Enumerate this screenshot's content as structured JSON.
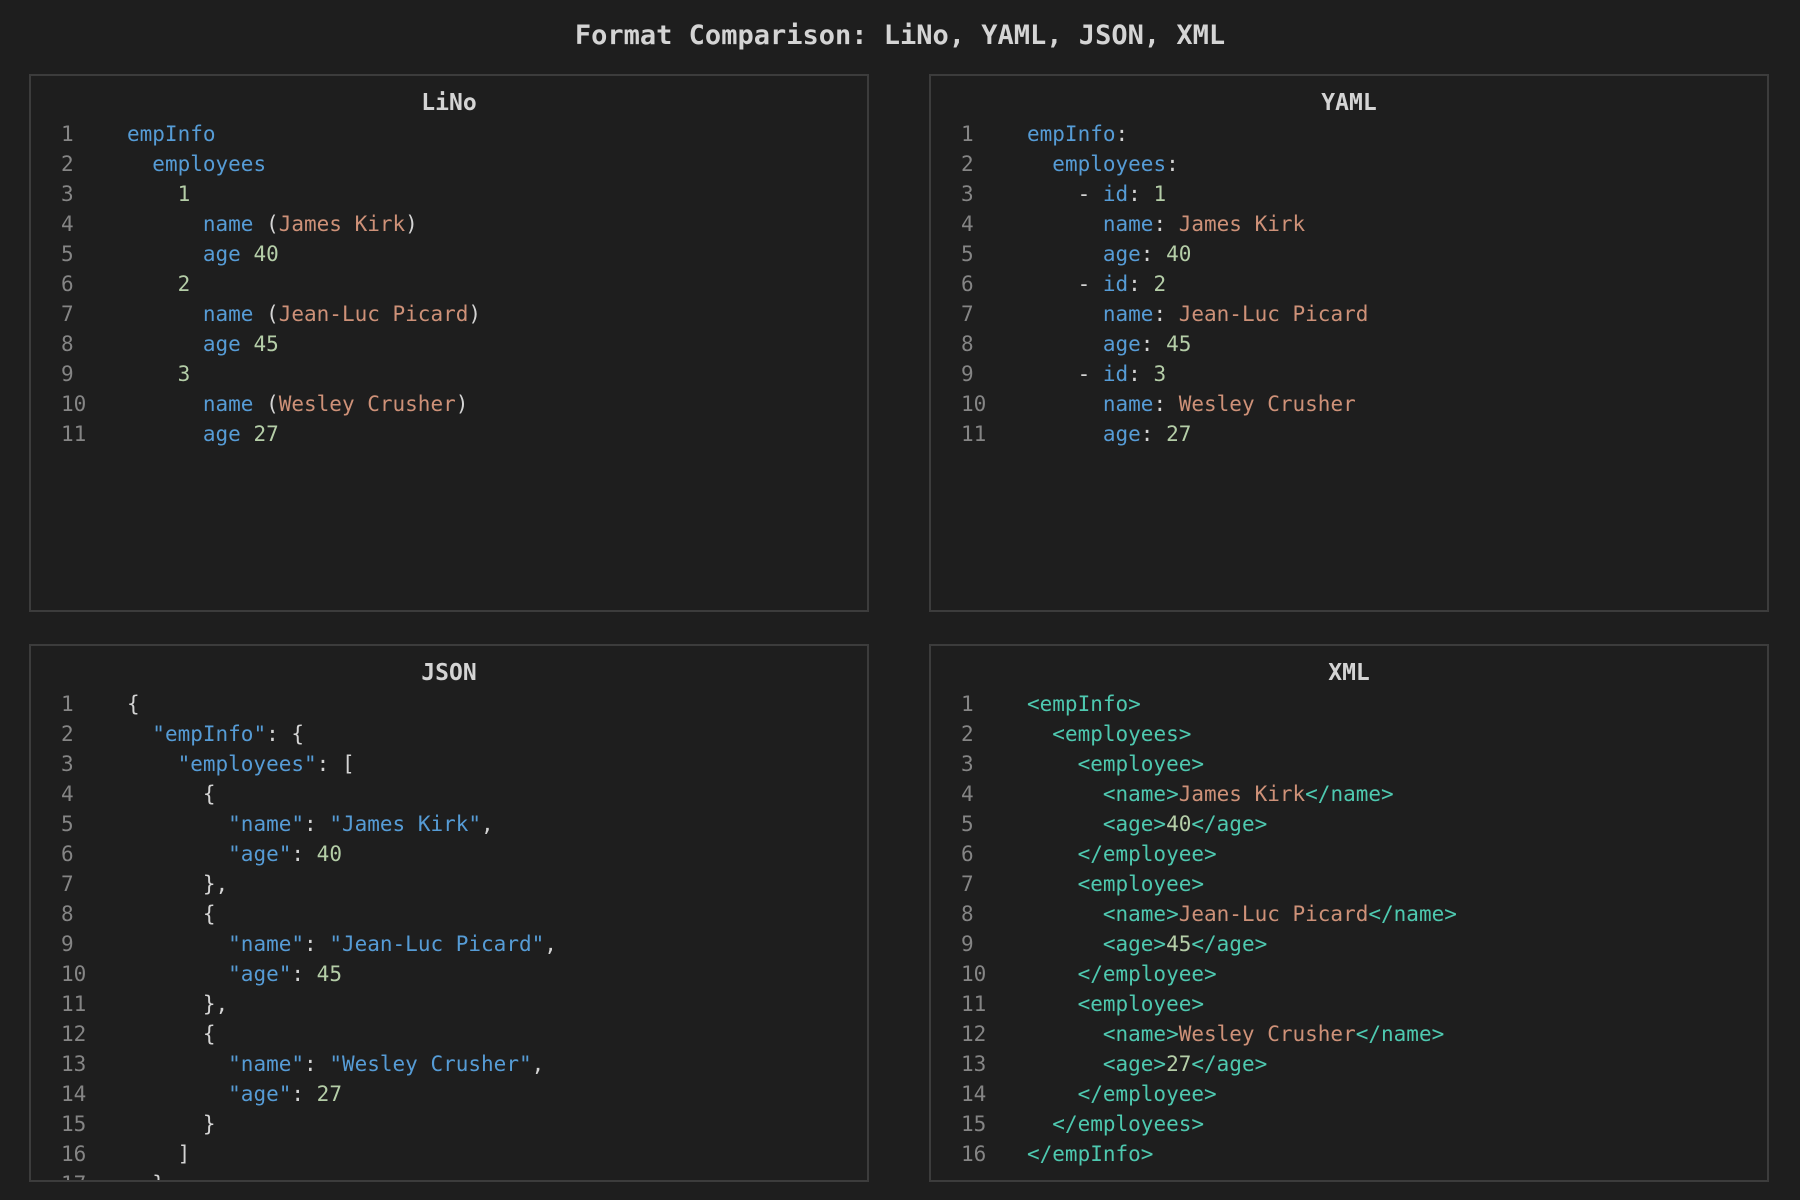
{
  "title": "Format Comparison: LiNo, YAML, JSON, XML",
  "colors": {
    "background": "#1e1e1e",
    "key": "#569cd6",
    "string": "#ce9178",
    "number": "#b5cea8",
    "punctuation": "#d4d4d4",
    "tag": "#4ec9b0",
    "line_number": "#858585",
    "border": "#3c3c3c"
  },
  "panels": [
    {
      "name": "LiNo",
      "lines": [
        [
          {
            "t": "empInfo",
            "c": "k"
          }
        ],
        [
          {
            "t": "  "
          },
          {
            "t": "employees",
            "c": "k"
          }
        ],
        [
          {
            "t": "    "
          },
          {
            "t": "1",
            "c": "n"
          }
        ],
        [
          {
            "t": "      "
          },
          {
            "t": "name",
            "c": "k"
          },
          {
            "t": " (",
            "c": "p"
          },
          {
            "t": "James Kirk",
            "c": "s"
          },
          {
            "t": ")",
            "c": "p"
          }
        ],
        [
          {
            "t": "      "
          },
          {
            "t": "age",
            "c": "k"
          },
          {
            "t": " "
          },
          {
            "t": "40",
            "c": "n"
          }
        ],
        [
          {
            "t": "    "
          },
          {
            "t": "2",
            "c": "n"
          }
        ],
        [
          {
            "t": "      "
          },
          {
            "t": "name",
            "c": "k"
          },
          {
            "t": " (",
            "c": "p"
          },
          {
            "t": "Jean-Luc Picard",
            "c": "s"
          },
          {
            "t": ")",
            "c": "p"
          }
        ],
        [
          {
            "t": "      "
          },
          {
            "t": "age",
            "c": "k"
          },
          {
            "t": " "
          },
          {
            "t": "45",
            "c": "n"
          }
        ],
        [
          {
            "t": "    "
          },
          {
            "t": "3",
            "c": "n"
          }
        ],
        [
          {
            "t": "      "
          },
          {
            "t": "name",
            "c": "k"
          },
          {
            "t": " (",
            "c": "p"
          },
          {
            "t": "Wesley Crusher",
            "c": "s"
          },
          {
            "t": ")",
            "c": "p"
          }
        ],
        [
          {
            "t": "      "
          },
          {
            "t": "age",
            "c": "k"
          },
          {
            "t": " "
          },
          {
            "t": "27",
            "c": "n"
          }
        ]
      ]
    },
    {
      "name": "YAML",
      "lines": [
        [
          {
            "t": "empInfo",
            "c": "k"
          },
          {
            "t": ":",
            "c": "p"
          }
        ],
        [
          {
            "t": "  "
          },
          {
            "t": "employees",
            "c": "k"
          },
          {
            "t": ":",
            "c": "p"
          }
        ],
        [
          {
            "t": "    "
          },
          {
            "t": "- ",
            "c": "p"
          },
          {
            "t": "id",
            "c": "k"
          },
          {
            "t": ": ",
            "c": "p"
          },
          {
            "t": "1",
            "c": "n"
          }
        ],
        [
          {
            "t": "      "
          },
          {
            "t": "name",
            "c": "k"
          },
          {
            "t": ": ",
            "c": "p"
          },
          {
            "t": "James Kirk",
            "c": "s"
          }
        ],
        [
          {
            "t": "      "
          },
          {
            "t": "age",
            "c": "k"
          },
          {
            "t": ": ",
            "c": "p"
          },
          {
            "t": "40",
            "c": "n"
          }
        ],
        [
          {
            "t": "    "
          },
          {
            "t": "- ",
            "c": "p"
          },
          {
            "t": "id",
            "c": "k"
          },
          {
            "t": ": ",
            "c": "p"
          },
          {
            "t": "2",
            "c": "n"
          }
        ],
        [
          {
            "t": "      "
          },
          {
            "t": "name",
            "c": "k"
          },
          {
            "t": ": ",
            "c": "p"
          },
          {
            "t": "Jean-Luc Picard",
            "c": "s"
          }
        ],
        [
          {
            "t": "      "
          },
          {
            "t": "age",
            "c": "k"
          },
          {
            "t": ": ",
            "c": "p"
          },
          {
            "t": "45",
            "c": "n"
          }
        ],
        [
          {
            "t": "    "
          },
          {
            "t": "- ",
            "c": "p"
          },
          {
            "t": "id",
            "c": "k"
          },
          {
            "t": ": ",
            "c": "p"
          },
          {
            "t": "3",
            "c": "n"
          }
        ],
        [
          {
            "t": "      "
          },
          {
            "t": "name",
            "c": "k"
          },
          {
            "t": ": ",
            "c": "p"
          },
          {
            "t": "Wesley Crusher",
            "c": "s"
          }
        ],
        [
          {
            "t": "      "
          },
          {
            "t": "age",
            "c": "k"
          },
          {
            "t": ": ",
            "c": "p"
          },
          {
            "t": "27",
            "c": "n"
          }
        ]
      ]
    },
    {
      "name": "JSON",
      "lines": [
        [
          {
            "t": "{",
            "c": "p"
          }
        ],
        [
          {
            "t": "  "
          },
          {
            "t": "\"empInfo\"",
            "c": "js"
          },
          {
            "t": ": {",
            "c": "p"
          }
        ],
        [
          {
            "t": "    "
          },
          {
            "t": "\"employees\"",
            "c": "js"
          },
          {
            "t": ": [",
            "c": "p"
          }
        ],
        [
          {
            "t": "      "
          },
          {
            "t": "{",
            "c": "p"
          }
        ],
        [
          {
            "t": "        "
          },
          {
            "t": "\"name\"",
            "c": "js"
          },
          {
            "t": ": ",
            "c": "p"
          },
          {
            "t": "\"James Kirk\"",
            "c": "js"
          },
          {
            "t": ",",
            "c": "p"
          }
        ],
        [
          {
            "t": "        "
          },
          {
            "t": "\"age\"",
            "c": "js"
          },
          {
            "t": ": ",
            "c": "p"
          },
          {
            "t": "40",
            "c": "n"
          }
        ],
        [
          {
            "t": "      "
          },
          {
            "t": "},",
            "c": "p"
          }
        ],
        [
          {
            "t": "      "
          },
          {
            "t": "{",
            "c": "p"
          }
        ],
        [
          {
            "t": "        "
          },
          {
            "t": "\"name\"",
            "c": "js"
          },
          {
            "t": ": ",
            "c": "p"
          },
          {
            "t": "\"Jean-Luc Picard\"",
            "c": "js"
          },
          {
            "t": ",",
            "c": "p"
          }
        ],
        [
          {
            "t": "        "
          },
          {
            "t": "\"age\"",
            "c": "js"
          },
          {
            "t": ": ",
            "c": "p"
          },
          {
            "t": "45",
            "c": "n"
          }
        ],
        [
          {
            "t": "      "
          },
          {
            "t": "},",
            "c": "p"
          }
        ],
        [
          {
            "t": "      "
          },
          {
            "t": "{",
            "c": "p"
          }
        ],
        [
          {
            "t": "        "
          },
          {
            "t": "\"name\"",
            "c": "js"
          },
          {
            "t": ": ",
            "c": "p"
          },
          {
            "t": "\"Wesley Crusher\"",
            "c": "js"
          },
          {
            "t": ",",
            "c": "p"
          }
        ],
        [
          {
            "t": "        "
          },
          {
            "t": "\"age\"",
            "c": "js"
          },
          {
            "t": ": ",
            "c": "p"
          },
          {
            "t": "27",
            "c": "n"
          }
        ],
        [
          {
            "t": "      "
          },
          {
            "t": "}",
            "c": "p"
          }
        ],
        [
          {
            "t": "    "
          },
          {
            "t": "]",
            "c": "p"
          }
        ],
        [
          {
            "t": "  "
          },
          {
            "t": "}",
            "c": "p"
          }
        ]
      ]
    },
    {
      "name": "XML",
      "lines": [
        [
          {
            "t": "<empInfo>",
            "c": "t"
          }
        ],
        [
          {
            "t": "  "
          },
          {
            "t": "<employees>",
            "c": "t"
          }
        ],
        [
          {
            "t": "    "
          },
          {
            "t": "<employee>",
            "c": "t"
          }
        ],
        [
          {
            "t": "      "
          },
          {
            "t": "<name>",
            "c": "t"
          },
          {
            "t": "James Kirk",
            "c": "s"
          },
          {
            "t": "</name>",
            "c": "t"
          }
        ],
        [
          {
            "t": "      "
          },
          {
            "t": "<age>",
            "c": "t"
          },
          {
            "t": "40",
            "c": "n"
          },
          {
            "t": "</age>",
            "c": "t"
          }
        ],
        [
          {
            "t": "    "
          },
          {
            "t": "</employee>",
            "c": "t"
          }
        ],
        [
          {
            "t": "    "
          },
          {
            "t": "<employee>",
            "c": "t"
          }
        ],
        [
          {
            "t": "      "
          },
          {
            "t": "<name>",
            "c": "t"
          },
          {
            "t": "Jean-Luc Picard",
            "c": "s"
          },
          {
            "t": "</name>",
            "c": "t"
          }
        ],
        [
          {
            "t": "      "
          },
          {
            "t": "<age>",
            "c": "t"
          },
          {
            "t": "45",
            "c": "n"
          },
          {
            "t": "</age>",
            "c": "t"
          }
        ],
        [
          {
            "t": "    "
          },
          {
            "t": "</employee>",
            "c": "t"
          }
        ],
        [
          {
            "t": "    "
          },
          {
            "t": "<employee>",
            "c": "t"
          }
        ],
        [
          {
            "t": "      "
          },
          {
            "t": "<name>",
            "c": "t"
          },
          {
            "t": "Wesley Crusher",
            "c": "s"
          },
          {
            "t": "</name>",
            "c": "t"
          }
        ],
        [
          {
            "t": "      "
          },
          {
            "t": "<age>",
            "c": "t"
          },
          {
            "t": "27",
            "c": "n"
          },
          {
            "t": "</age>",
            "c": "t"
          }
        ],
        [
          {
            "t": "    "
          },
          {
            "t": "</employee>",
            "c": "t"
          }
        ],
        [
          {
            "t": "  "
          },
          {
            "t": "</employees>",
            "c": "t"
          }
        ],
        [
          {
            "t": "</empInfo>",
            "c": "t"
          }
        ]
      ]
    }
  ]
}
